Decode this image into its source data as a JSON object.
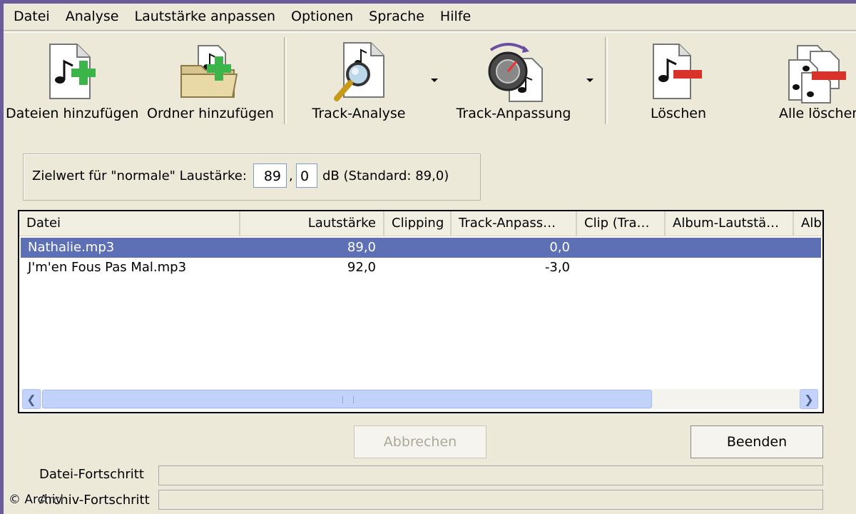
{
  "menu": [
    "Datei",
    "Analyse",
    "Lautstärke anpassen",
    "Optionen",
    "Sprache",
    "Hilfe"
  ],
  "toolbar": {
    "add_files": "Dateien hinzufügen",
    "add_folder": "Ordner hinzufügen",
    "track_analysis": "Track-Analyse",
    "track_adjust": "Track-Anpassung",
    "delete": "Löschen",
    "delete_all": "Alle löschen"
  },
  "target": {
    "label": "Zielwert für \"normale\" Laustärke:",
    "integer_value": "89",
    "comma": ",",
    "decimal_value": "0",
    "unit_text": "dB  (Standard: 89,0)"
  },
  "table": {
    "columns": [
      "Datei",
      "Lautstärke",
      "Clipping",
      "Track-Anpass…",
      "Clip (Tra…",
      "Album-Lautstä…",
      "Alb"
    ],
    "rows": [
      {
        "file": "Nathalie.mp3",
        "loudness": "89,0",
        "clipping": "",
        "track_adjust": "0,0",
        "selected": true
      },
      {
        "file": "J'm'en Fous Pas Mal.mp3",
        "loudness": "92,0",
        "clipping": "",
        "track_adjust": "-3,0",
        "selected": false
      }
    ]
  },
  "buttons": {
    "cancel": "Abbrechen",
    "exit": "Beenden"
  },
  "progress": {
    "file_label": "Datei-Fortschritt",
    "file_value": 0,
    "archive_label": "Archiv-Fortschritt",
    "archive_value": 0
  },
  "watermark": "© Archiv"
}
